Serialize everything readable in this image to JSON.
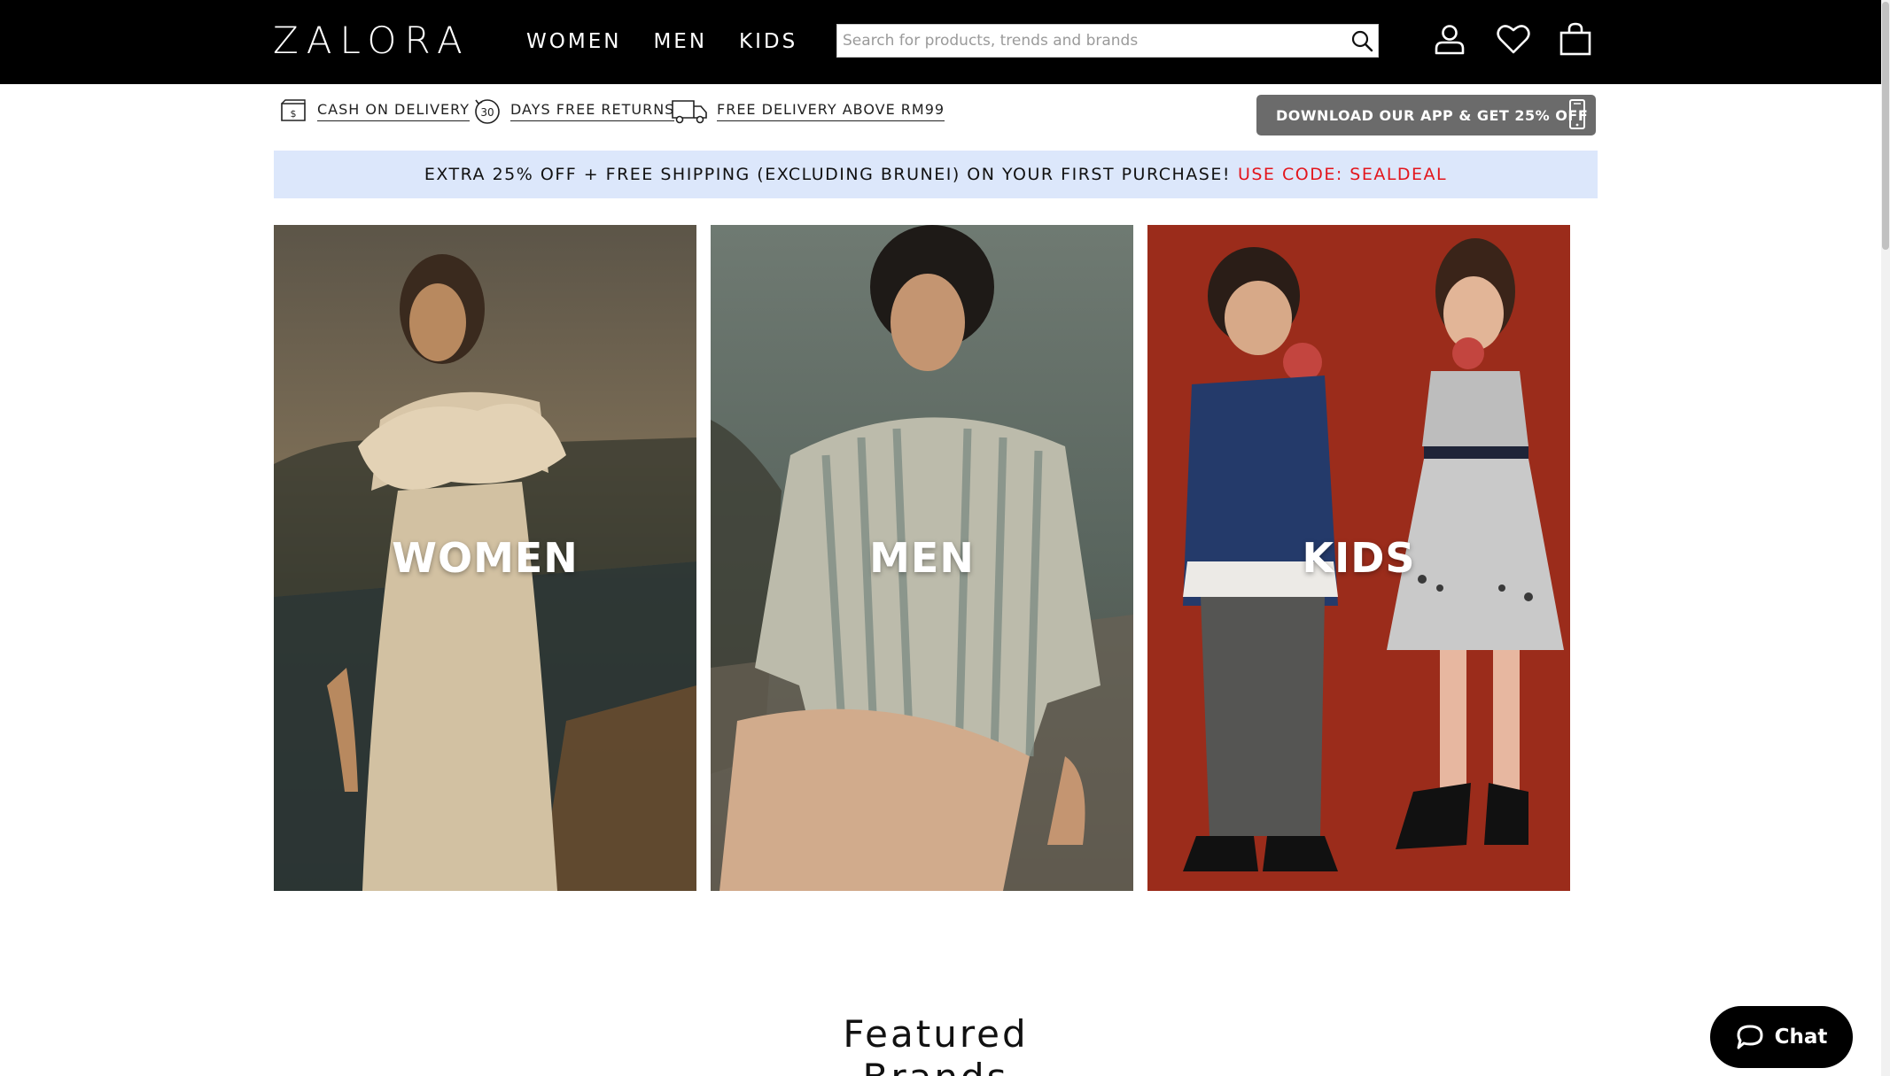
{
  "header": {
    "logo": "ZALORA",
    "nav": [
      {
        "label": "WOMEN"
      },
      {
        "label": "MEN"
      },
      {
        "label": "KIDS"
      }
    ],
    "search_placeholder": "Search for products, trends and brands",
    "icons": [
      "search-icon",
      "account-icon",
      "wishlist-heart-icon",
      "shopping-bag-icon"
    ]
  },
  "usp": {
    "cod": "CASH ON DELIVERY",
    "cod_icon_text": "$",
    "returns": "DAYS FREE RETURNS",
    "returns_icon_text": "30",
    "delivery": "FREE DELIVERY ABOVE RM99",
    "app_button": "DOWNLOAD OUR APP & GET 25% OFF"
  },
  "promo": {
    "text": "EXTRA 25% OFF + FREE SHIPPING (EXCLUDING BRUNEI) ON YOUR FIRST PURCHASE!",
    "code": "USE CODE: SEALDEAL"
  },
  "tiles": [
    {
      "label": "WOMEN"
    },
    {
      "label": "MEN"
    },
    {
      "label": "KIDS"
    }
  ],
  "featured": {
    "title": "Featured Brands"
  },
  "chat": {
    "label": "Chat"
  },
  "colors": {
    "header_bg": "#000000",
    "promo_bg": "#dce7fb",
    "promo_code": "#e3151c",
    "app_button_bg": "#6b6b6b",
    "kids_tile_bg": "#a5301e"
  }
}
